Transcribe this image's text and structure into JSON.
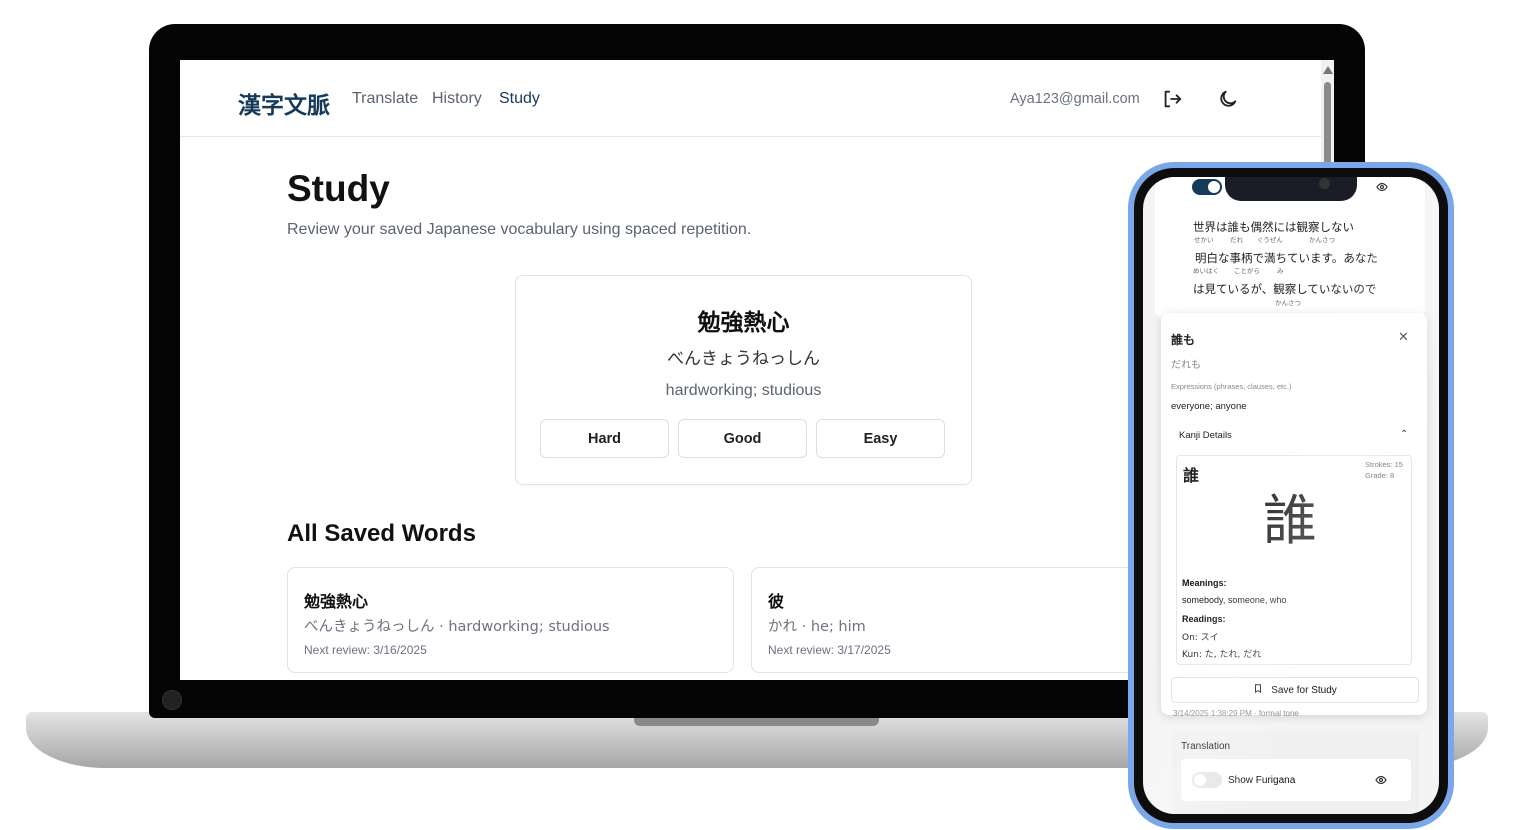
{
  "app": {
    "logo": "漢字文脈",
    "nav": [
      "Translate",
      "History",
      "Study"
    ],
    "user_email": "Aya123@gmail.com",
    "icons": {
      "logout": "logout-icon",
      "theme": "moon-icon"
    }
  },
  "study": {
    "title": "Study",
    "subtitle": "Review your saved Japanese vocabulary using spaced repetition.",
    "card": {
      "kanji": "勉強熱心",
      "reading": "べんきょうねっしん",
      "meaning": "hardworking; studious",
      "buttons": [
        "Hard",
        "Good",
        "Easy"
      ]
    },
    "saved_heading": "All Saved Words",
    "saved_words": [
      {
        "kanji": "勉強熱心",
        "detail": "べんきょうねっしん · hardworking; studious",
        "next": "Next review: 3/16/2025"
      },
      {
        "kanji": "彼",
        "detail": "かれ · he; him",
        "next": "Next review: 3/17/2025"
      }
    ]
  },
  "phone": {
    "sentence_lines": [
      {
        "text": "世界は誰も偶然には観察しない",
        "furigana": [
          "せかい",
          "だれ",
          "ぐうぜん",
          "かんさつ"
        ]
      },
      {
        "text": "明白な事柄で満ちています。あなた",
        "furigana": [
          "めいはく",
          "ことがら",
          "み"
        ]
      },
      {
        "text": "は見ているが、観察していないので",
        "furigana": [
          "かんさつ"
        ]
      }
    ],
    "popup": {
      "word": "誰も",
      "reading": "だれも",
      "pos": "Expressions (phrases, clauses, etc.)",
      "meaning": "everyone; anyone",
      "kanji_details_label": "Kanji Details",
      "kanji": "誰",
      "strokes": "Strokes: 15",
      "grade": "Grade: 8",
      "meanings_label": "Meanings:",
      "meanings": "somebody, someone, who",
      "readings_label": "Readings:",
      "on": "On: スイ",
      "kun": "Kun: た, たれ, だれ",
      "save_label": "Save for Study"
    },
    "timestamp": "3/14/2025 1:38:29 PM · formal tone",
    "translation_label": "Translation",
    "show_furigana_label": "Show Furigana",
    "toggle_on_color": "#163a5a"
  }
}
